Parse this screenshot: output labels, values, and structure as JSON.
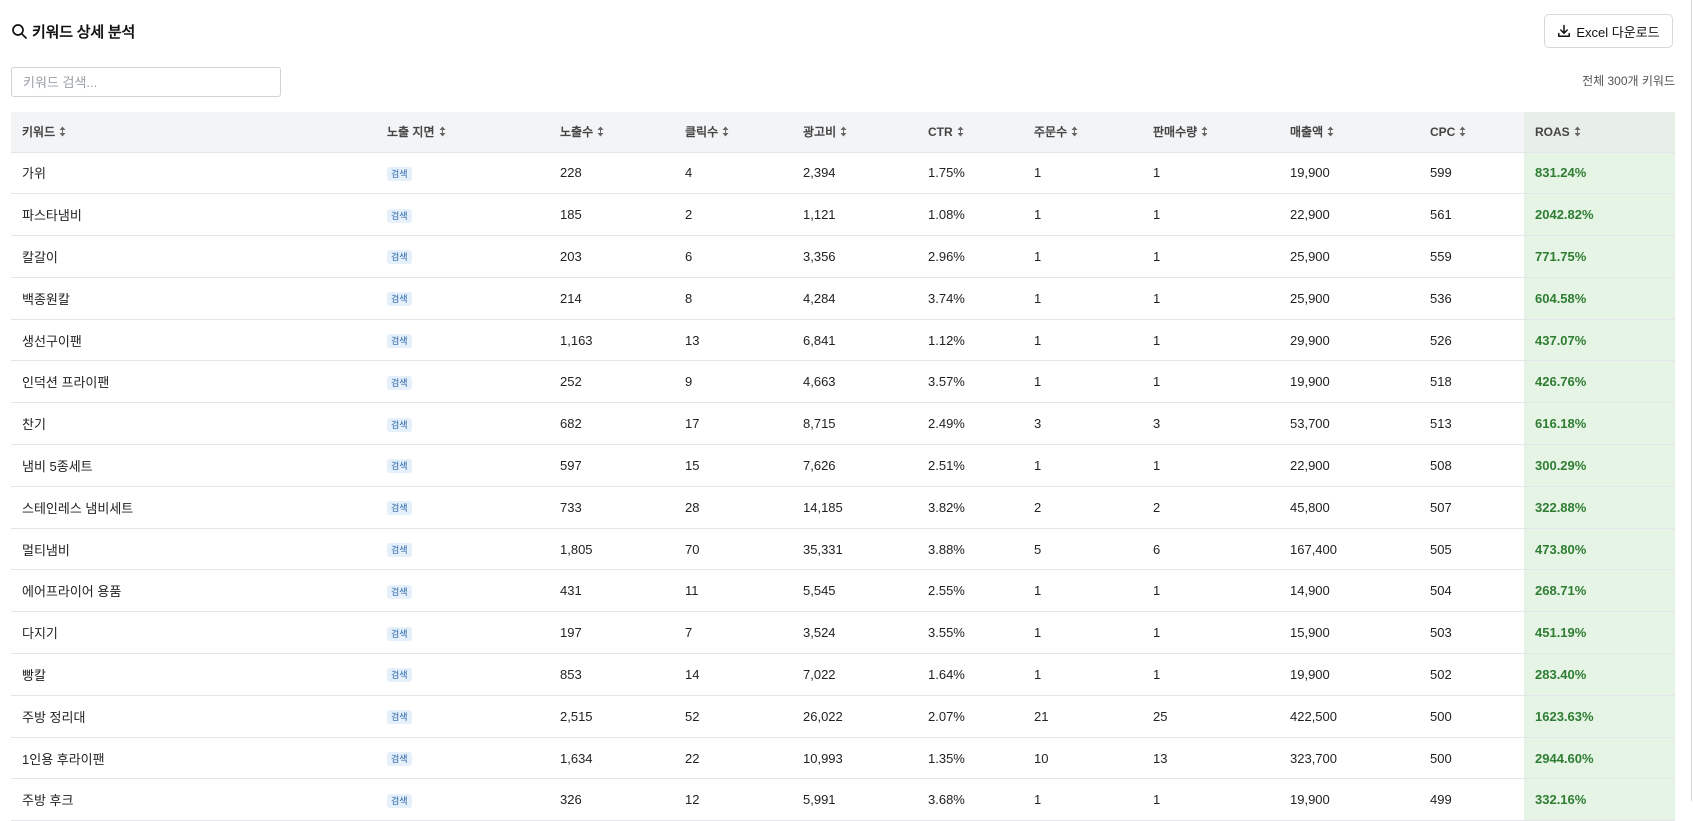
{
  "header": {
    "title": "키워드 상세 분석"
  },
  "toolbar": {
    "excel_label": "Excel 다운로드"
  },
  "search": {
    "placeholder": "키워드 검색...",
    "value": ""
  },
  "summary": {
    "total_text": "전체 300개 키워드"
  },
  "colors": {
    "roas_bg": "#e6f4e6",
    "roas_text": "#2e7d32",
    "badge_text": "#2563a8",
    "badge_bg": "#e6f0fb"
  },
  "icons": {
    "title": "search-icon",
    "download": "download-icon",
    "sort": "sort-icon"
  },
  "table": {
    "columns": [
      "키워드",
      "노출 지면",
      "노출수",
      "클릭수",
      "광고비",
      "CTR",
      "주문수",
      "판매수량",
      "매출액",
      "CPC",
      "ROAS"
    ],
    "rows": [
      [
        "가위",
        "검색",
        "228",
        "4",
        "2,394",
        "1.75%",
        "1",
        "1",
        "19,900",
        "599",
        "831.24%"
      ],
      [
        "파스타냄비",
        "검색",
        "185",
        "2",
        "1,121",
        "1.08%",
        "1",
        "1",
        "22,900",
        "561",
        "2042.82%"
      ],
      [
        "칼갈이",
        "검색",
        "203",
        "6",
        "3,356",
        "2.96%",
        "1",
        "1",
        "25,900",
        "559",
        "771.75%"
      ],
      [
        "백종원칼",
        "검색",
        "214",
        "8",
        "4,284",
        "3.74%",
        "1",
        "1",
        "25,900",
        "536",
        "604.58%"
      ],
      [
        "생선구이팬",
        "검색",
        "1,163",
        "13",
        "6,841",
        "1.12%",
        "1",
        "1",
        "29,900",
        "526",
        "437.07%"
      ],
      [
        "인덕션 프라이팬",
        "검색",
        "252",
        "9",
        "4,663",
        "3.57%",
        "1",
        "1",
        "19,900",
        "518",
        "426.76%"
      ],
      [
        "찬기",
        "검색",
        "682",
        "17",
        "8,715",
        "2.49%",
        "3",
        "3",
        "53,700",
        "513",
        "616.18%"
      ],
      [
        "냄비 5종세트",
        "검색",
        "597",
        "15",
        "7,626",
        "2.51%",
        "1",
        "1",
        "22,900",
        "508",
        "300.29%"
      ],
      [
        "스테인레스 냄비세트",
        "검색",
        "733",
        "28",
        "14,185",
        "3.82%",
        "2",
        "2",
        "45,800",
        "507",
        "322.88%"
      ],
      [
        "멀티냄비",
        "검색",
        "1,805",
        "70",
        "35,331",
        "3.88%",
        "5",
        "6",
        "167,400",
        "505",
        "473.80%"
      ],
      [
        "에어프라이어 용품",
        "검색",
        "431",
        "11",
        "5,545",
        "2.55%",
        "1",
        "1",
        "14,900",
        "504",
        "268.71%"
      ],
      [
        "다지기",
        "검색",
        "197",
        "7",
        "3,524",
        "3.55%",
        "1",
        "1",
        "15,900",
        "503",
        "451.19%"
      ],
      [
        "빵칼",
        "검색",
        "853",
        "14",
        "7,022",
        "1.64%",
        "1",
        "1",
        "19,900",
        "502",
        "283.40%"
      ],
      [
        "주방 정리대",
        "검색",
        "2,515",
        "52",
        "26,022",
        "2.07%",
        "21",
        "25",
        "422,500",
        "500",
        "1623.63%"
      ],
      [
        "1인용 후라이팬",
        "검색",
        "1,634",
        "22",
        "10,993",
        "1.35%",
        "10",
        "13",
        "323,700",
        "500",
        "2944.60%"
      ],
      [
        "주방 후크",
        "검색",
        "326",
        "12",
        "5,991",
        "3.68%",
        "1",
        "1",
        "19,900",
        "499",
        "332.16%"
      ]
    ]
  }
}
